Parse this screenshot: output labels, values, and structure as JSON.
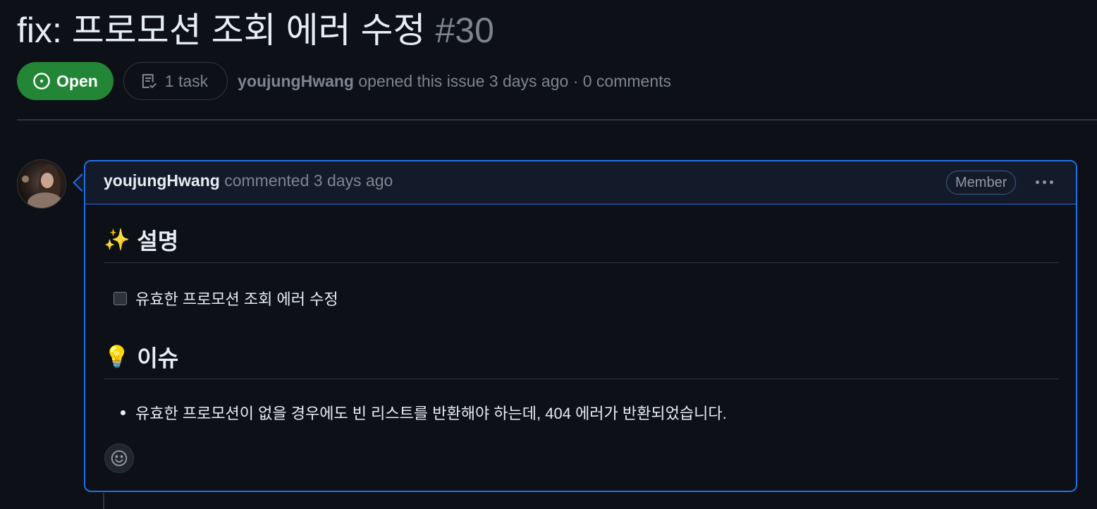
{
  "issue": {
    "title": "fix: 프로모션 조회 에러 수정",
    "number": "#30",
    "state": "Open",
    "tasks": "1 task",
    "author": "youjungHwang",
    "opened_text": "opened this issue 3 days ago · 0 comments"
  },
  "comment": {
    "author": "youjungHwang",
    "time_text": "commented 3 days ago",
    "role": "Member",
    "sections": [
      {
        "icon": "✨",
        "heading": "설명",
        "task": {
          "checked": false,
          "text": "유효한 프로모션 조회 에러 수정"
        }
      },
      {
        "icon": "💡",
        "heading": "이슈",
        "bullet": "유효한 프로모션이 없을 경우에도 빈 리스트를 반환해야 하는데, 404 에러가 반환되었습니다."
      }
    ]
  },
  "colors": {
    "background": "#0d1117",
    "open_green": "#238636",
    "accent_blue": "#1f6feb",
    "muted": "#7d8590"
  },
  "icons": {
    "state": "issue-opened-icon",
    "tasks": "checklist-icon",
    "more": "kebab-horizontal-icon",
    "reaction": "smiley-icon"
  }
}
